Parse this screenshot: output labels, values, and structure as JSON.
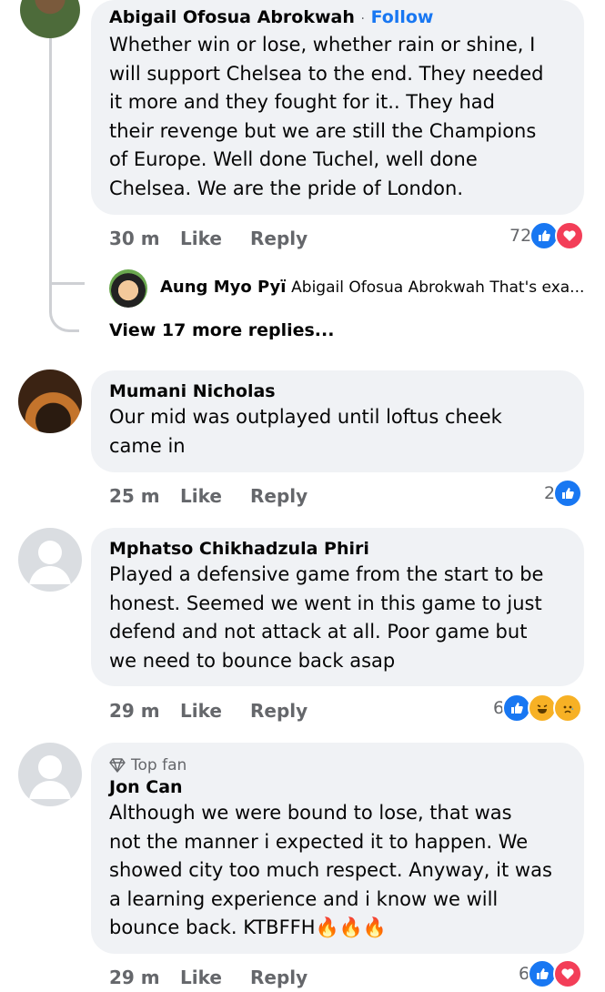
{
  "comments": [
    {
      "name": "Abigail Ofosua Abrokwah",
      "follow_sep": "·",
      "follow": "Follow",
      "lines": [
        "Whether win or lose, whether rain or shine, I",
        "will support Chelsea to the end. They needed",
        "it more and they fought for it.. They had",
        "their revenge but we are still the Champions",
        "of Europe. Well done Tuchel, well done",
        "Chelsea. We are the pride of London."
      ],
      "time": "30 m",
      "like": "Like",
      "reply": "Reply",
      "reaction_count": "72",
      "reactions": [
        "like-icon",
        "love-icon"
      ]
    },
    {
      "name": "Mumani Nicholas",
      "lines": [
        "Our mid was outplayed until loftus cheek",
        "came in"
      ],
      "time": "25 m",
      "like": "Like",
      "reply": "Reply",
      "reaction_count": "2",
      "reactions": [
        "like-icon"
      ]
    },
    {
      "name": "Mphatso Chikhadzula Phiri",
      "lines": [
        "Played a defensive game from the start to be",
        "honest. Seemed we went in this game to just",
        "defend and not attack at all. Poor game but",
        "we need to bounce back asap"
      ],
      "time": "29 m",
      "like": "Like",
      "reply": "Reply",
      "reaction_count": "6",
      "reactions": [
        "like-icon",
        "haha-icon",
        "sad-icon"
      ]
    },
    {
      "badge": "Top fan",
      "name": "Jon Can",
      "lines": [
        "Although we were bound to lose, that was",
        "not the manner i expected it to happen. We",
        "showed city too much respect. Anyway, it was",
        "a learning experience and i know we will",
        "bounce back. KTBFFH🔥🔥🔥"
      ],
      "time": "29 m",
      "like": "Like",
      "reply": "Reply",
      "reaction_count": "6",
      "reactions": [
        "like-icon",
        "love-icon"
      ]
    }
  ],
  "reply_preview": {
    "name": "Aung Myo Pyï",
    "text": "Abigail Ofosua Abrokwah That's exa..."
  },
  "view_more": "View 17 more replies...",
  "colors": {
    "bubble": "#f0f2f5",
    "link": "#1877f2",
    "meta": "#65676b",
    "like": "#1877f2",
    "love": "#f33e58",
    "haha": "#f7b125"
  }
}
